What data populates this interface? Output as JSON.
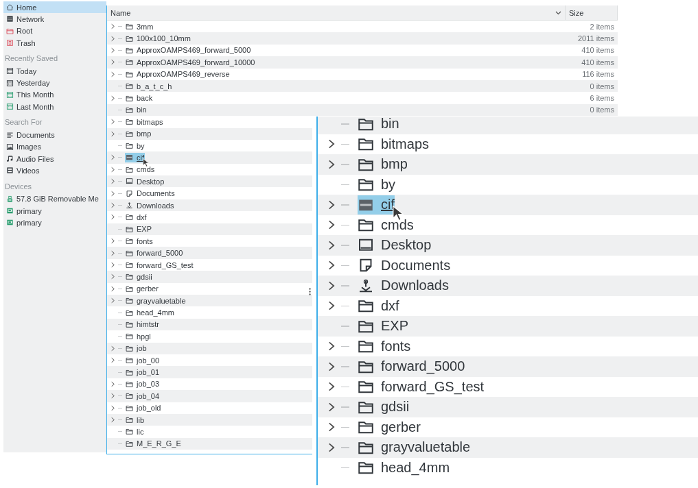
{
  "sidebar": {
    "sections": [
      {
        "items": [
          {
            "label": "Home",
            "kind": "home",
            "selected": true
          },
          {
            "label": "Network",
            "kind": "network",
            "selected": false
          },
          {
            "label": "Root",
            "kind": "root",
            "selected": false
          },
          {
            "label": "Trash",
            "kind": "trash",
            "selected": false
          }
        ]
      },
      {
        "heading": "Recently Saved",
        "items": [
          {
            "label": "Today",
            "kind": "calendar",
            "selected": false
          },
          {
            "label": "Yesterday",
            "kind": "calendar",
            "selected": false
          },
          {
            "label": "This Month",
            "kind": "month",
            "selected": false
          },
          {
            "label": "Last Month",
            "kind": "month",
            "selected": false
          }
        ]
      },
      {
        "heading": "Search For",
        "items": [
          {
            "label": "Documents",
            "kind": "text",
            "selected": false
          },
          {
            "label": "Images",
            "kind": "image",
            "selected": false
          },
          {
            "label": "Audio Files",
            "kind": "audio",
            "selected": false
          },
          {
            "label": "Videos",
            "kind": "video",
            "selected": false
          }
        ]
      },
      {
        "heading": "Devices",
        "items": [
          {
            "label": "57.8 GiB Removable Me",
            "kind": "usb",
            "selected": false
          },
          {
            "label": "primary",
            "kind": "disk",
            "selected": false
          },
          {
            "label": "primary",
            "kind": "disk",
            "selected": false
          }
        ]
      }
    ]
  },
  "file_list": {
    "columns": [
      "Name",
      "Size"
    ],
    "rows": [
      {
        "name": "3mm",
        "size": "2 items",
        "expandable": true,
        "kind": "folder",
        "selected": false
      },
      {
        "name": "100x100_10mm",
        "size": "2011 items",
        "expandable": true,
        "kind": "folder",
        "selected": false
      },
      {
        "name": "ApproxOAMPS469_forward_5000",
        "size": "410 items",
        "expandable": true,
        "kind": "folder",
        "selected": false
      },
      {
        "name": "ApproxOAMPS469_forward_10000",
        "size": "410 items",
        "expandable": true,
        "kind": "folder",
        "selected": false
      },
      {
        "name": "ApproxOAMPS469_reverse",
        "size": "116 items",
        "expandable": true,
        "kind": "folder",
        "selected": false
      },
      {
        "name": "b_a_t_c_h",
        "size": "0 items",
        "expandable": false,
        "kind": "folder",
        "selected": false
      },
      {
        "name": "back",
        "size": "6 items",
        "expandable": true,
        "kind": "folder",
        "selected": false
      },
      {
        "name": "bin",
        "size": "0 items",
        "expandable": false,
        "kind": "folder",
        "selected": false
      },
      {
        "name": "bitmaps",
        "expandable": true,
        "kind": "folder",
        "selected": false
      },
      {
        "name": "bmp",
        "expandable": true,
        "kind": "folder",
        "selected": false
      },
      {
        "name": "by",
        "expandable": false,
        "kind": "folder",
        "selected": false
      },
      {
        "name": "cif",
        "expandable": true,
        "kind": "folder",
        "selected": true
      },
      {
        "name": "cmds",
        "expandable": true,
        "kind": "folder",
        "selected": false
      },
      {
        "name": "Desktop",
        "expandable": true,
        "kind": "desktop",
        "selected": false
      },
      {
        "name": "Documents",
        "expandable": true,
        "kind": "document",
        "selected": false
      },
      {
        "name": "Downloads",
        "expandable": true,
        "kind": "download",
        "selected": false
      },
      {
        "name": "dxf",
        "expandable": true,
        "kind": "folder",
        "selected": false
      },
      {
        "name": "EXP",
        "expandable": false,
        "kind": "folder",
        "selected": false
      },
      {
        "name": "fonts",
        "expandable": true,
        "kind": "folder",
        "selected": false
      },
      {
        "name": "forward_5000",
        "expandable": true,
        "kind": "folder",
        "selected": false
      },
      {
        "name": "forward_GS_test",
        "expandable": true,
        "kind": "folder",
        "selected": false
      },
      {
        "name": "gdsii",
        "expandable": true,
        "kind": "folder",
        "selected": false
      },
      {
        "name": "gerber",
        "expandable": true,
        "kind": "folder",
        "selected": false
      },
      {
        "name": "grayvaluetable",
        "expandable": true,
        "kind": "folder",
        "selected": false
      },
      {
        "name": "head_4mm",
        "expandable": false,
        "kind": "folder",
        "selected": false
      },
      {
        "name": "himtstr",
        "expandable": false,
        "kind": "folder",
        "selected": false
      },
      {
        "name": "hpgl",
        "expandable": false,
        "kind": "folder",
        "selected": false
      },
      {
        "name": "job",
        "expandable": true,
        "kind": "folder",
        "selected": false
      },
      {
        "name": "job_00",
        "expandable": true,
        "kind": "folder",
        "selected": false
      },
      {
        "name": "job_01",
        "expandable": false,
        "kind": "folder",
        "selected": false
      },
      {
        "name": "job_03",
        "expandable": true,
        "kind": "folder",
        "selected": false
      },
      {
        "name": "job_04",
        "expandable": true,
        "kind": "folder",
        "selected": false
      },
      {
        "name": "job_old",
        "expandable": true,
        "kind": "folder",
        "selected": false
      },
      {
        "name": "lib",
        "expandable": true,
        "kind": "folder",
        "selected": false
      },
      {
        "name": "lic",
        "expandable": false,
        "kind": "folder",
        "selected": false
      },
      {
        "name": "M_E_R_G_E",
        "expandable": false,
        "kind": "folder",
        "selected": false
      }
    ]
  },
  "zoom_inset": {
    "rows": [
      {
        "name": "bin",
        "expandable": false,
        "kind": "folder",
        "selected": false
      },
      {
        "name": "bitmaps",
        "expandable": true,
        "kind": "folder",
        "selected": false
      },
      {
        "name": "bmp",
        "expandable": true,
        "kind": "folder",
        "selected": false
      },
      {
        "name": "by",
        "expandable": false,
        "kind": "folder",
        "selected": false
      },
      {
        "name": "cif",
        "expandable": true,
        "kind": "folder",
        "selected": true
      },
      {
        "name": "cmds",
        "expandable": true,
        "kind": "folder",
        "selected": false
      },
      {
        "name": "Desktop",
        "expandable": true,
        "kind": "desktop",
        "selected": false
      },
      {
        "name": "Documents",
        "expandable": true,
        "kind": "document",
        "selected": false
      },
      {
        "name": "Downloads",
        "expandable": true,
        "kind": "download",
        "selected": false
      },
      {
        "name": "dxf",
        "expandable": true,
        "kind": "folder",
        "selected": false
      },
      {
        "name": "EXP",
        "expandable": false,
        "kind": "folder",
        "selected": false
      },
      {
        "name": "fonts",
        "expandable": true,
        "kind": "folder",
        "selected": false
      },
      {
        "name": "forward_5000",
        "expandable": true,
        "kind": "folder",
        "selected": false
      },
      {
        "name": "forward_GS_test",
        "expandable": true,
        "kind": "folder",
        "selected": false
      },
      {
        "name": "gdsii",
        "expandable": true,
        "kind": "folder",
        "selected": false
      },
      {
        "name": "gerber",
        "expandable": true,
        "kind": "folder",
        "selected": false
      },
      {
        "name": "grayvaluetable",
        "expandable": true,
        "kind": "folder",
        "selected": false
      },
      {
        "name": "head_4mm",
        "expandable": false,
        "kind": "folder",
        "selected": false
      }
    ]
  }
}
